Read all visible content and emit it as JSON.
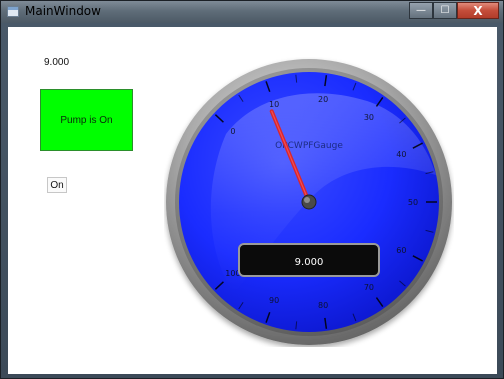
{
  "window": {
    "title": "MainWindow",
    "controls": {
      "minimize": "—",
      "maximize": "☐",
      "close": "X"
    }
  },
  "main": {
    "value_text": "9.000",
    "pump_label": "Pump is On",
    "on_button_label": "On"
  },
  "gauge": {
    "title": "OPCWPFGauge",
    "readout": "9.000",
    "value": 9,
    "min": 0,
    "max": 100,
    "major_labels": [
      "0",
      "10",
      "20",
      "30",
      "40",
      "50",
      "60",
      "70",
      "80",
      "90",
      "100"
    ],
    "colors": {
      "face": "#1a2cff",
      "bezel": "#8a8a8a",
      "needle": "#d9262f",
      "readout_bg": "#0b0b0b"
    }
  }
}
